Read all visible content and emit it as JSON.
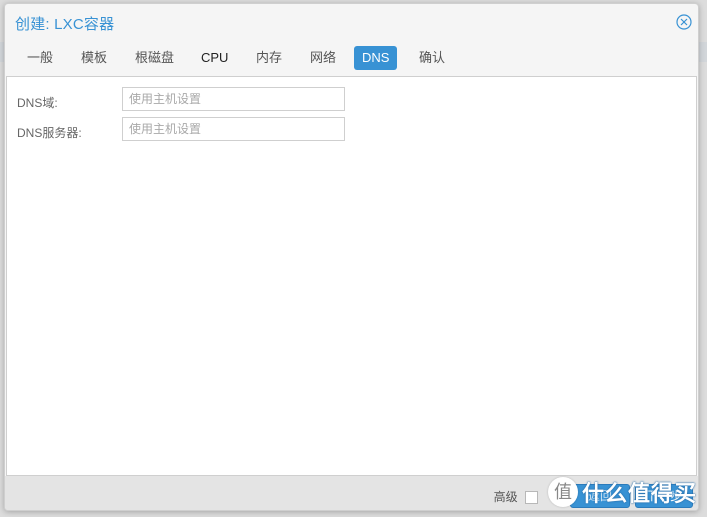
{
  "window": {
    "title": "创建: LXC容器"
  },
  "tabs": [
    {
      "label": "一般",
      "active": false
    },
    {
      "label": "模板",
      "active": false
    },
    {
      "label": "根磁盘",
      "active": false
    },
    {
      "label": "CPU",
      "active": false
    },
    {
      "label": "内存",
      "active": false
    },
    {
      "label": "网络",
      "active": false
    },
    {
      "label": "DNS",
      "active": true
    },
    {
      "label": "确认",
      "active": false
    }
  ],
  "form": {
    "dns_domain": {
      "label": "DNS域:",
      "value": "",
      "placeholder": "使用主机设置"
    },
    "dns_servers": {
      "label": "DNS服务器:",
      "value": "",
      "placeholder": "使用主机设置"
    }
  },
  "footer": {
    "advanced_label": "高级",
    "back_label": "返回",
    "next_label": "下一步"
  },
  "watermark": {
    "badge": "值",
    "text": "什么值得买"
  },
  "colors": {
    "accent": "#3892d4",
    "footer_bg": "#e4e4e4",
    "dialog_bg": "#f5f5f5"
  },
  "icons": {
    "close": "close-circle-icon"
  }
}
